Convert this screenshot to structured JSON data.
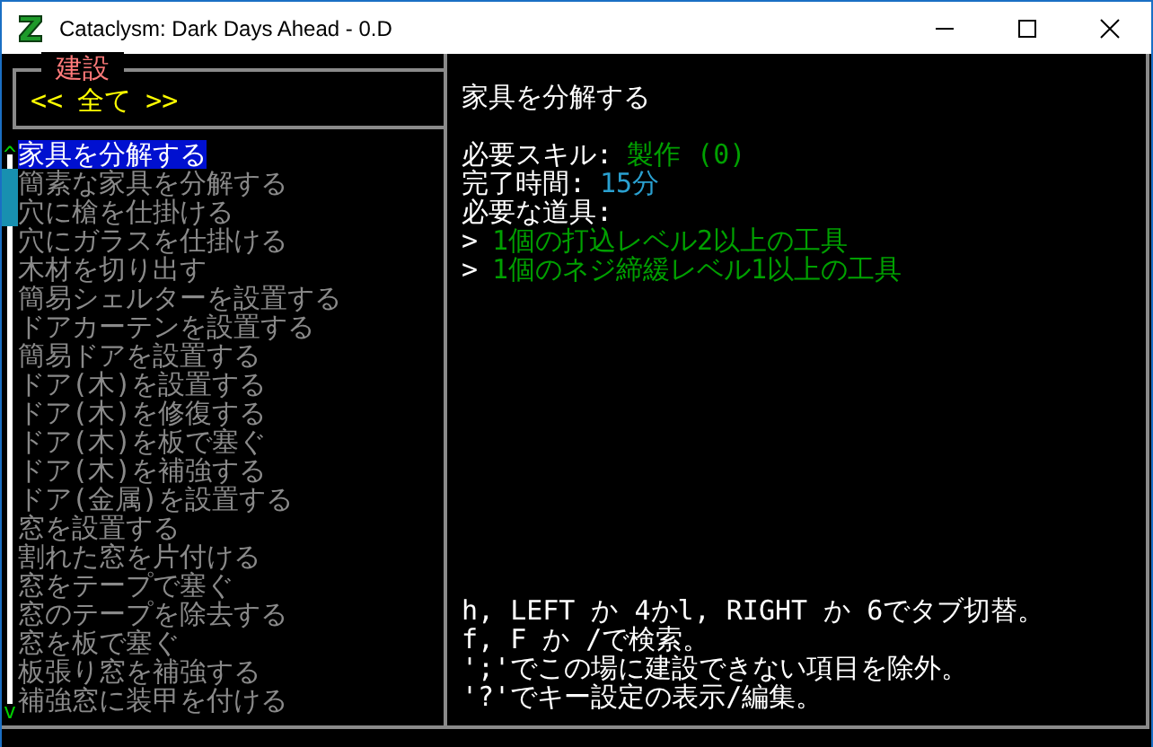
{
  "window": {
    "title": "Cataclysm: Dark Days Ahead - 0.D"
  },
  "category": {
    "title": "建設",
    "prev": "<<",
    "tab": "全て",
    "next": ">>"
  },
  "scroll": {
    "up": "^",
    "down": "v"
  },
  "items": [
    {
      "label": "家具を分解する",
      "selected": true
    },
    {
      "label": "簡素な家具を分解する",
      "selected": false
    },
    {
      "label": "穴に槍を仕掛ける",
      "selected": false
    },
    {
      "label": "穴にガラスを仕掛ける",
      "selected": false
    },
    {
      "label": "木材を切り出す",
      "selected": false
    },
    {
      "label": "簡易シェルターを設置する",
      "selected": false
    },
    {
      "label": "ドアカーテンを設置する",
      "selected": false
    },
    {
      "label": "簡易ドアを設置する",
      "selected": false
    },
    {
      "label": "ドア(木)を設置する",
      "selected": false
    },
    {
      "label": "ドア(木)を修復する",
      "selected": false
    },
    {
      "label": "ドア(木)を板で塞ぐ",
      "selected": false
    },
    {
      "label": "ドア(木)を補強する",
      "selected": false
    },
    {
      "label": "ドア(金属)を設置する",
      "selected": false
    },
    {
      "label": "窓を設置する",
      "selected": false
    },
    {
      "label": "割れた窓を片付ける",
      "selected": false
    },
    {
      "label": "窓をテープで塞ぐ",
      "selected": false
    },
    {
      "label": "窓のテープを除去する",
      "selected": false
    },
    {
      "label": "窓を板で塞ぐ",
      "selected": false
    },
    {
      "label": "板張り窓を補強する",
      "selected": false
    },
    {
      "label": "補強窓に装甲を付ける",
      "selected": false
    }
  ],
  "detail": {
    "title": "家具を分解する",
    "skill_label": "必要スキル:",
    "skill_value": "製作 (0)",
    "time_label": "完了時間:",
    "time_value": "15分",
    "tools_label": "必要な道具:",
    "tools": [
      {
        "marker": ">",
        "text": "1個の打込レベル2以上の工具"
      },
      {
        "marker": ">",
        "text": "1個のネジ締緩レベル1以上の工具"
      }
    ]
  },
  "help": [
    "h, LEFT か 4かl, RIGHT か 6でタブ切替。",
    "f, F か /で検索。",
    "';'でこの場に建設できない項目を除外。",
    "'?'でキー設定の表示/編集。"
  ]
}
